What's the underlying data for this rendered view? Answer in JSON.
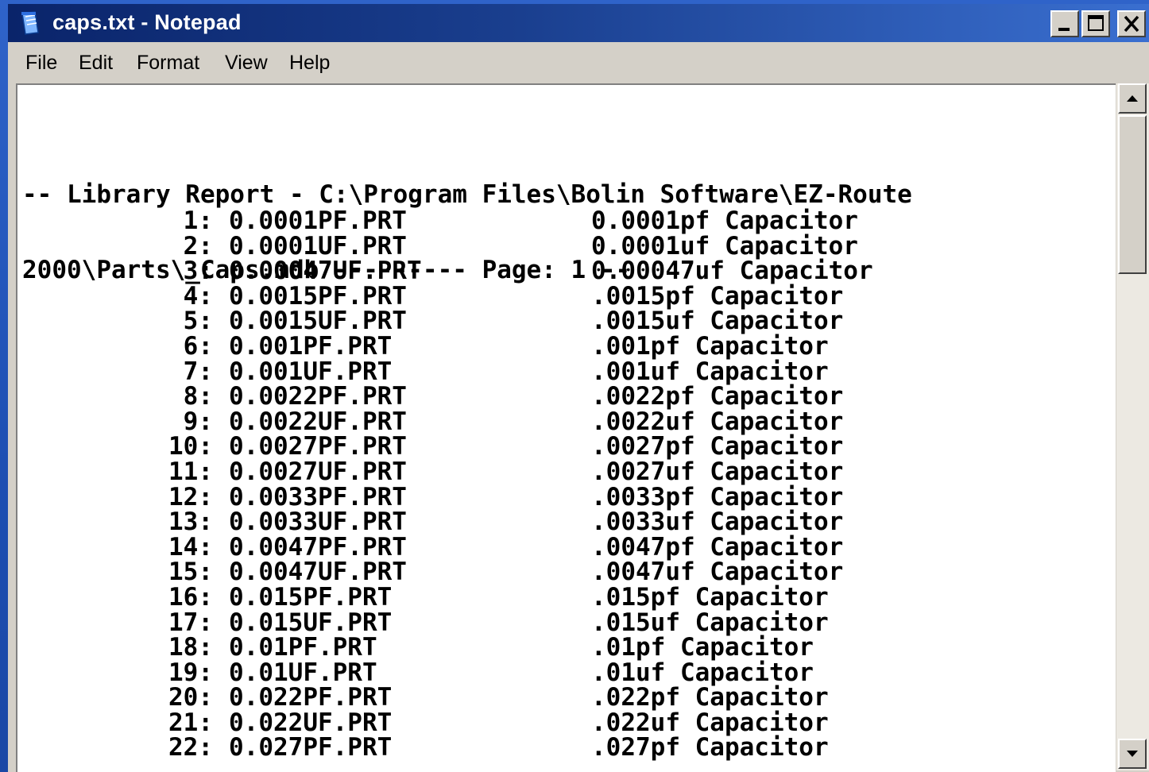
{
  "window": {
    "title": "caps.txt - Notepad",
    "icon": "notepad-icon"
  },
  "controls": {
    "minimize": "minimize-icon",
    "maximize": "maximize-icon",
    "close": "close-icon"
  },
  "menu": {
    "items": [
      "File",
      "Edit",
      "Format",
      "View",
      "Help"
    ]
  },
  "document": {
    "header_line_1": "-- Library Report - C:\\Program Files\\Bolin Software\\EZ-Route",
    "header_line_2": "2000\\Parts\\_Caps.mdb --------- Page: 1 --",
    "rows": [
      {
        "num": "1:",
        "file": "0.0001PF.PRT",
        "desc": "0.0001pf Capacitor"
      },
      {
        "num": "2:",
        "file": "0.0001UF.PRT",
        "desc": "0.0001uf Capacitor"
      },
      {
        "num": "3:",
        "file": "0.00047UF.PRT",
        "desc": "0.00047uf Capacitor"
      },
      {
        "num": "4:",
        "file": "0.0015PF.PRT",
        "desc": ".0015pf Capacitor"
      },
      {
        "num": "5:",
        "file": "0.0015UF.PRT",
        "desc": ".0015uf Capacitor"
      },
      {
        "num": "6:",
        "file": "0.001PF.PRT",
        "desc": ".001pf Capacitor"
      },
      {
        "num": "7:",
        "file": "0.001UF.PRT",
        "desc": ".001uf Capacitor"
      },
      {
        "num": "8:",
        "file": "0.0022PF.PRT",
        "desc": ".0022pf Capacitor"
      },
      {
        "num": "9:",
        "file": "0.0022UF.PRT",
        "desc": ".0022uf Capacitor"
      },
      {
        "num": "10:",
        "file": "0.0027PF.PRT",
        "desc": ".0027pf Capacitor"
      },
      {
        "num": "11:",
        "file": "0.0027UF.PRT",
        "desc": ".0027uf Capacitor"
      },
      {
        "num": "12:",
        "file": "0.0033PF.PRT",
        "desc": ".0033pf Capacitor"
      },
      {
        "num": "13:",
        "file": "0.0033UF.PRT",
        "desc": ".0033uf Capacitor"
      },
      {
        "num": "14:",
        "file": "0.0047PF.PRT",
        "desc": ".0047pf Capacitor"
      },
      {
        "num": "15:",
        "file": "0.0047UF.PRT",
        "desc": ".0047uf Capacitor"
      },
      {
        "num": "16:",
        "file": "0.015PF.PRT",
        "desc": ".015pf Capacitor"
      },
      {
        "num": "17:",
        "file": "0.015UF.PRT",
        "desc": ".015uf Capacitor"
      },
      {
        "num": "18:",
        "file": "0.01PF.PRT",
        "desc": ".01pf Capacitor"
      },
      {
        "num": "19:",
        "file": "0.01UF.PRT",
        "desc": ".01uf Capacitor"
      },
      {
        "num": "20:",
        "file": "0.022PF.PRT",
        "desc": ".022pf Capacitor"
      },
      {
        "num": "21:",
        "file": "0.022UF.PRT",
        "desc": ".022uf Capacitor"
      },
      {
        "num": "22:",
        "file": "0.027PF.PRT",
        "desc": ".027pf Capacitor"
      }
    ]
  },
  "scrollbar": {
    "up": "scroll-up-arrow-icon",
    "down": "scroll-down-arrow-icon"
  },
  "colors": {
    "titlebar_start": "#0a246a",
    "titlebar_end": "#3a6fd0",
    "chrome": "#d4d0c8",
    "text": "#000000"
  }
}
